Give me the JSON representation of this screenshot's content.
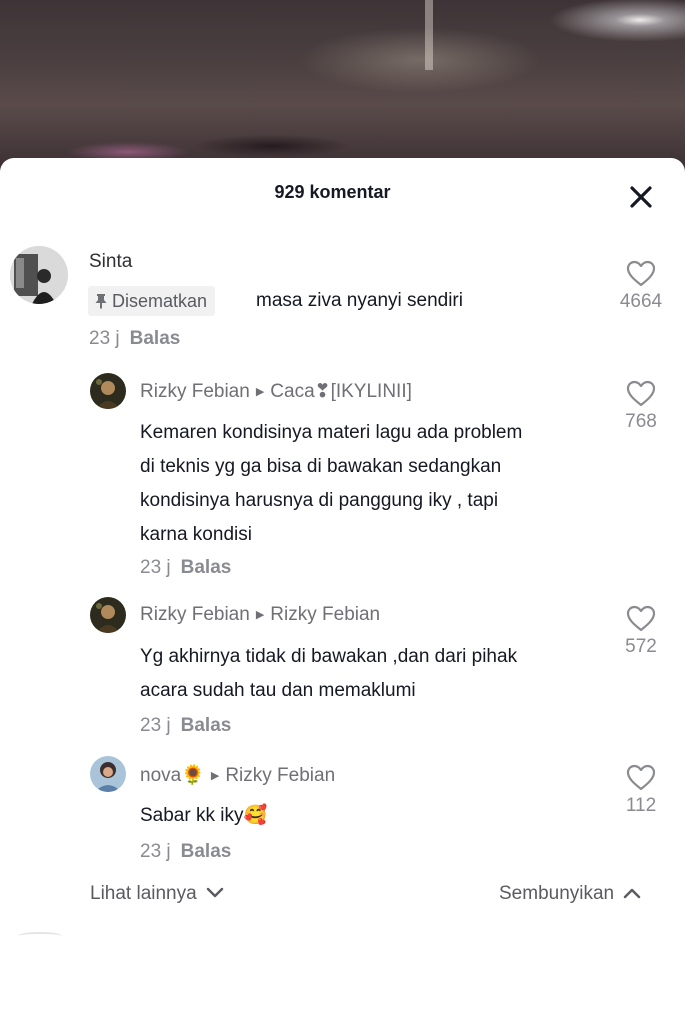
{
  "header": {
    "comment_count": "929 komentar"
  },
  "comments": [
    {
      "author": "Sinta",
      "reply_to": "",
      "pinned_label": "Disematkan",
      "text": "masa ziva nyanyi sendiri",
      "time": "23 j",
      "reply_label": "Balas",
      "likes": "4664"
    },
    {
      "author": "Rizky Febian",
      "reply_to": "Caca❣[IKYLINII]",
      "text_lines": [
        "Kemaren kondisinya materi lagu ada problem",
        "di teknis yg ga bisa di bawakan sedangkan",
        "kondisinya harusnya di panggung iky , tapi",
        "karna kondisi"
      ],
      "time": "23 j",
      "reply_label": "Balas",
      "likes": "768"
    },
    {
      "author": "Rizky Febian",
      "reply_to": "Rizky Febian",
      "text_lines": [
        "Yg akhirnya tidak di bawakan ,dan dari pihak",
        "acara sudah tau dan memaklumi"
      ],
      "time": "23 j",
      "reply_label": "Balas",
      "likes": "572"
    },
    {
      "author": "nova🌻",
      "reply_to": "Rizky Febian",
      "text_lines": [
        "Sabar kk iky🥰"
      ],
      "time": "23 j",
      "reply_label": "Balas",
      "likes": "112"
    }
  ],
  "footer": {
    "more_label": "Lihat lainnya",
    "hide_label": "Sembunyikan"
  },
  "icons": {
    "close": "close-icon",
    "like": "heart-outline-icon",
    "pin": "pin-icon",
    "chevron_down": "chevron-down-icon",
    "chevron_up": "chevron-up-icon"
  }
}
